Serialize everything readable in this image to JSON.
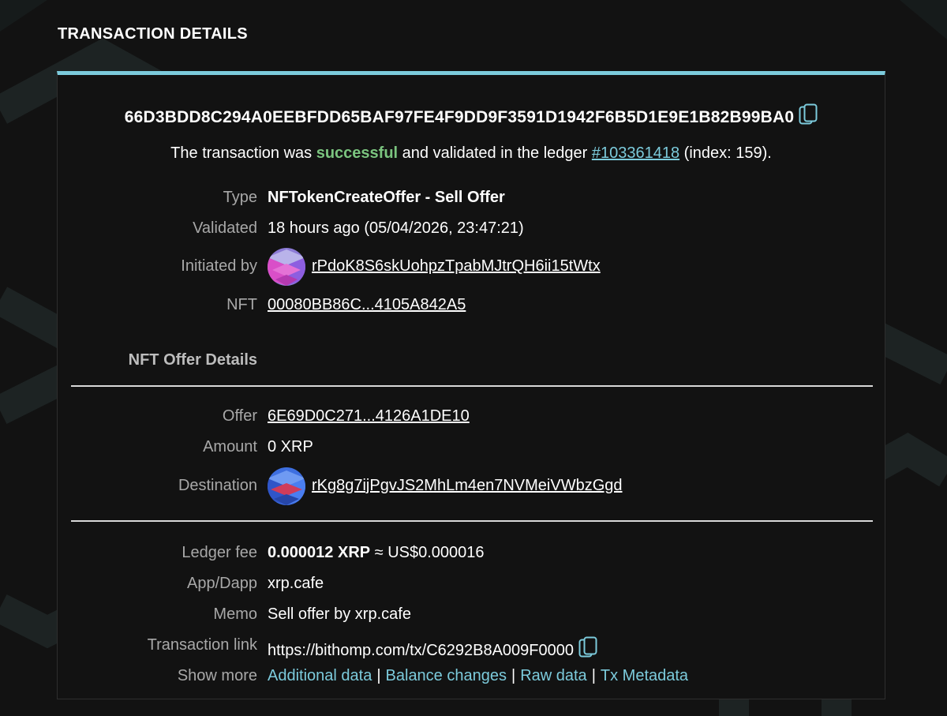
{
  "page": {
    "heading": "TRANSACTION DETAILS"
  },
  "transaction": {
    "hash": "66D3BDD8C294A0EEBFDD65BAF97FE4F9DD9F3591D1942F6B5D1E9E1B82B99BA0",
    "summary_prefix": "The transaction was",
    "status": "successful",
    "summary_mid": "and validated in the ledger",
    "ledger": "#103361418",
    "index_text": "(index: 159)."
  },
  "details": {
    "type_label": "Type",
    "type_value": "NFTokenCreateOffer - Sell Offer",
    "validated_label": "Validated",
    "validated_value": "18 hours ago (05/04/2026, 23:47:21)",
    "initiated_label": "Initiated by",
    "initiated_value": "rPdoK8S6skUohpzTpabMJtrQH6ii15tWtx",
    "nft_label": "NFT",
    "nft_value": "00080BB86C...4105A842A5"
  },
  "offer_section": {
    "title": "NFT Offer Details",
    "offer_label": "Offer",
    "offer_value": "6E69D0C271...4126A1DE10",
    "amount_label": "Amount",
    "amount_value": "0 XRP",
    "destination_label": "Destination",
    "destination_value": "rKg8g7ijPgvJS2MhLm4en7NVMeiVWbzGgd"
  },
  "fee_section": {
    "fee_label": "Ledger fee",
    "fee_amount": "0.000012 XRP",
    "fee_fiat": "≈ US$0.000016",
    "app_label": "App/Dapp",
    "app_value": "xrp.cafe",
    "memo_label": "Memo",
    "memo_value": "Sell offer by xrp.cafe",
    "txlink_label": "Transaction link",
    "txlink_value": "https://bithomp.com/tx/C6292B8A009F0000",
    "showmore_label": "Show more",
    "showmore_links": [
      "Additional data",
      "Balance changes",
      "Raw data",
      "Tx Metadata"
    ],
    "separator": "|"
  },
  "colors": {
    "accent": "#7ccbdc",
    "success": "#7bc47f",
    "label": "#a8a8a8",
    "background": "#121212"
  },
  "icons": [
    "copy-icon",
    "avatar-initiator",
    "avatar-destination"
  ]
}
